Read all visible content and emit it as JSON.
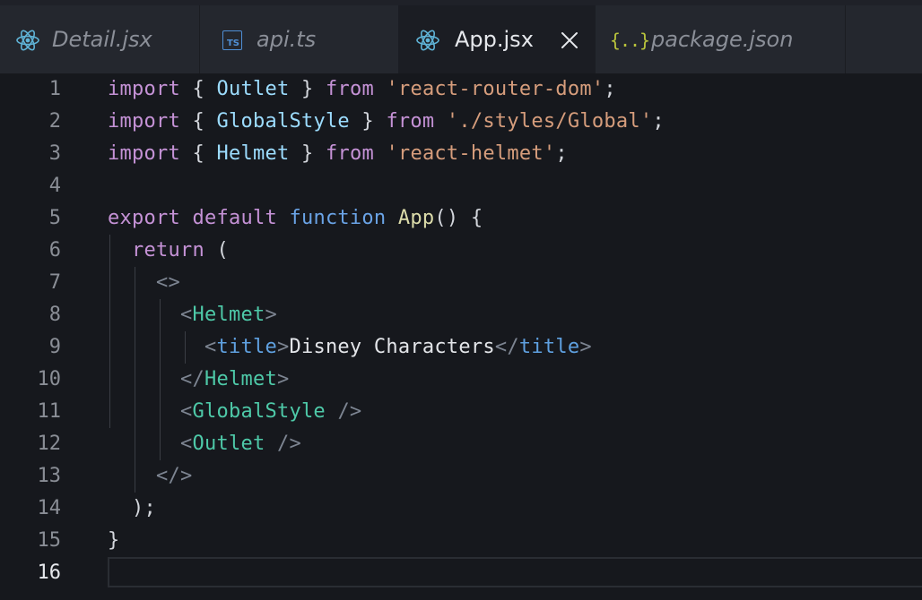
{
  "tabs": [
    {
      "label": "Detail.jsx",
      "icon": "react-icon",
      "active": false
    },
    {
      "label": "api.ts",
      "icon": "typescript-icon",
      "icon_text": "TS",
      "active": false
    },
    {
      "label": "App.jsx",
      "icon": "react-icon",
      "active": true,
      "close": "×"
    },
    {
      "label": "package.json",
      "icon": "json-icon",
      "icon_text": "{..}",
      "active": false
    }
  ],
  "colors": {
    "react_icon": "#5fb3d6",
    "typescript_icon": "#4f8fd6",
    "json_icon": "#b8c33c",
    "keyword": "#c592d6",
    "function_keyword": "#6aa3e6",
    "identifier": "#9cdcfe",
    "string": "#d69d7c",
    "jsx_tag": "#4ec9a8"
  },
  "editor": {
    "current_line": 16,
    "lines": [
      {
        "n": "1",
        "tokens": [
          [
            "kw",
            "import"
          ],
          [
            "pun",
            " { "
          ],
          [
            "id",
            "Outlet"
          ],
          [
            "pun",
            " } "
          ],
          [
            "kw",
            "from"
          ],
          [
            "pun",
            " "
          ],
          [
            "str",
            "'react-router-dom'"
          ],
          [
            "pun",
            ";"
          ]
        ]
      },
      {
        "n": "2",
        "tokens": [
          [
            "kw",
            "import"
          ],
          [
            "pun",
            " { "
          ],
          [
            "id",
            "GlobalStyle"
          ],
          [
            "pun",
            " } "
          ],
          [
            "kw",
            "from"
          ],
          [
            "pun",
            " "
          ],
          [
            "str",
            "'./styles/Global'"
          ],
          [
            "pun",
            ";"
          ]
        ]
      },
      {
        "n": "3",
        "tokens": [
          [
            "kw",
            "import"
          ],
          [
            "pun",
            " { "
          ],
          [
            "id",
            "Helmet"
          ],
          [
            "pun",
            " } "
          ],
          [
            "kw",
            "from"
          ],
          [
            "pun",
            " "
          ],
          [
            "str",
            "'react-helmet'"
          ],
          [
            "pun",
            ";"
          ]
        ]
      },
      {
        "n": "4",
        "tokens": []
      },
      {
        "n": "5",
        "tokens": [
          [
            "kw",
            "export"
          ],
          [
            "pun",
            " "
          ],
          [
            "kw",
            "default"
          ],
          [
            "pun",
            " "
          ],
          [
            "fn",
            "function"
          ],
          [
            "pun",
            " "
          ],
          [
            "def",
            "App"
          ],
          [
            "pun",
            "() {"
          ]
        ]
      },
      {
        "n": "6",
        "tokens": [
          [
            "pun",
            "  "
          ],
          [
            "kw",
            "return"
          ],
          [
            "pun",
            " ("
          ]
        ]
      },
      {
        "n": "7",
        "tokens": [
          [
            "pun",
            "    "
          ],
          [
            "brk",
            "<>"
          ]
        ]
      },
      {
        "n": "8",
        "tokens": [
          [
            "pun",
            "      "
          ],
          [
            "brk",
            "<"
          ],
          [
            "tag",
            "Helmet"
          ],
          [
            "brk",
            ">"
          ]
        ]
      },
      {
        "n": "9",
        "tokens": [
          [
            "pun",
            "        "
          ],
          [
            "brk",
            "<"
          ],
          [
            "tagb",
            "title"
          ],
          [
            "brk",
            ">"
          ],
          [
            "txt",
            "Disney Characters"
          ],
          [
            "brk",
            "</"
          ],
          [
            "tagb",
            "title"
          ],
          [
            "brk",
            ">"
          ]
        ]
      },
      {
        "n": "10",
        "tokens": [
          [
            "pun",
            "      "
          ],
          [
            "brk",
            "</"
          ],
          [
            "tag",
            "Helmet"
          ],
          [
            "brk",
            ">"
          ]
        ]
      },
      {
        "n": "11",
        "tokens": [
          [
            "pun",
            "      "
          ],
          [
            "brk",
            "<"
          ],
          [
            "tag",
            "GlobalStyle"
          ],
          [
            "pun",
            " "
          ],
          [
            "brk",
            "/>"
          ]
        ]
      },
      {
        "n": "12",
        "tokens": [
          [
            "pun",
            "      "
          ],
          [
            "brk",
            "<"
          ],
          [
            "tag",
            "Outlet"
          ],
          [
            "pun",
            " "
          ],
          [
            "brk",
            "/>"
          ]
        ]
      },
      {
        "n": "13",
        "tokens": [
          [
            "pun",
            "    "
          ],
          [
            "brk",
            "</>"
          ]
        ]
      },
      {
        "n": "14",
        "tokens": [
          [
            "pun",
            "  );"
          ]
        ]
      },
      {
        "n": "15",
        "tokens": [
          [
            "pun",
            "}"
          ]
        ]
      },
      {
        "n": "16",
        "tokens": []
      }
    ]
  }
}
